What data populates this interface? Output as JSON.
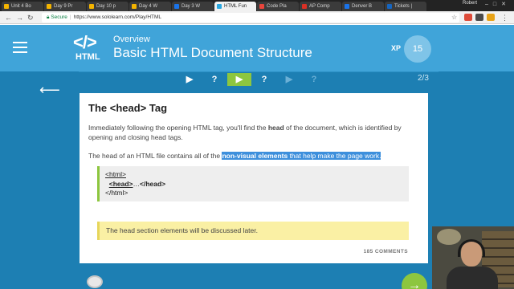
{
  "browser": {
    "tabs": [
      {
        "label": "Unit 4 Bo",
        "color": "#f4b400",
        "active": false
      },
      {
        "label": "Day 9 Pr",
        "color": "#f4b400",
        "active": false
      },
      {
        "label": "Day 10 p",
        "color": "#f4b400",
        "active": false
      },
      {
        "label": "Day 4 W",
        "color": "#f4b400",
        "active": false
      },
      {
        "label": "Day 3 W",
        "color": "#1a73e8",
        "active": false
      },
      {
        "label": "HTML Fun",
        "color": "#2aa7e0",
        "active": true
      },
      {
        "label": "Code Pla",
        "color": "#e8453c",
        "active": false
      },
      {
        "label": "AP Comp",
        "color": "#d93025",
        "active": false
      },
      {
        "label": "Denver B",
        "color": "#1a73e8",
        "active": false
      },
      {
        "label": "Tickets |",
        "color": "#1565c0",
        "active": false
      }
    ],
    "profile_name": "Robert",
    "url_secure_label": "Secure",
    "url": "https://www.sololearn.com/Play/HTML"
  },
  "header": {
    "logo_code": "</>",
    "logo_text": "HTML",
    "overview_label": "Overview",
    "title": "Basic HTML Document Structure",
    "xp_label": "XP",
    "xp_value": "15"
  },
  "progress": {
    "steps": [
      {
        "glyph": "▶",
        "state": "done"
      },
      {
        "glyph": "?",
        "state": "done"
      },
      {
        "glyph": "▶",
        "state": "active"
      },
      {
        "glyph": "?",
        "state": "done"
      },
      {
        "glyph": "▶",
        "state": "pending"
      },
      {
        "glyph": "?",
        "state": "pending"
      }
    ],
    "page_indicator": "2/3"
  },
  "lesson": {
    "title": "The <head> Tag",
    "p1_before": "Immediately following the opening HTML tag, you'll find the ",
    "p1_bold": "head",
    "p1_after": " of the document, which is identified by opening and closing head tags.",
    "p2_before": "The head of an HTML file contains all of the ",
    "p2_bold_highlight": "non-visual elements",
    "p2_highlight": " that help make the page work.",
    "code_line1": "<html>",
    "code_line2_tag": "<head>",
    "code_line2_dots": "…",
    "code_line2_close": "</head>",
    "code_line3": "</html>",
    "note": "The head section elements will be discussed later.",
    "comments": "185 COMMENTS"
  },
  "colors": {
    "header_bg": "#40a4d9",
    "content_bg": "#1d7fb3",
    "accent_green": "#8dc63f",
    "note_bg": "#faf0a4"
  }
}
